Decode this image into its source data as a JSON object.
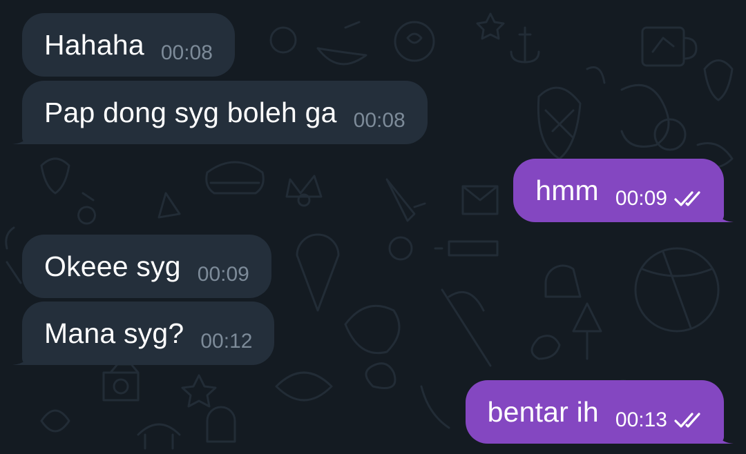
{
  "colors": {
    "background": "#141b22",
    "incoming_bubble": "#242f3b",
    "outgoing_bubble": "#8447c1",
    "incoming_time": "#7d8b99"
  },
  "messages": [
    {
      "direction": "incoming",
      "text": "Hahaha",
      "time": "00:08"
    },
    {
      "direction": "incoming",
      "text": "Pap dong syg boleh ga",
      "time": "00:08"
    },
    {
      "direction": "outgoing",
      "text": "hmm",
      "time": "00:09",
      "status_icon": "double-check-icon"
    },
    {
      "direction": "incoming",
      "text": "Okeee syg",
      "time": "00:09"
    },
    {
      "direction": "incoming",
      "text": "Mana syg?",
      "time": "00:12"
    },
    {
      "direction": "outgoing",
      "text": "bentar ih",
      "time": "00:13",
      "status_icon": "double-check-icon"
    }
  ]
}
